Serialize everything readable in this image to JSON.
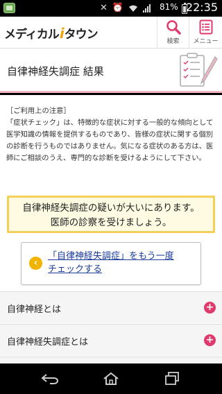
{
  "status_bar": {
    "battery": "81%",
    "time": "22:35"
  },
  "header": {
    "logo_pre": "メディカル",
    "logo_i": "i",
    "logo_post": "タウン",
    "search_label": "検索",
    "menu_label": "メニュー"
  },
  "page": {
    "title": "自律神経失調症 結果"
  },
  "notice": {
    "heading": "［ご利用上の注意］",
    "body": "「症状チェック」は、特徴的な症状に対する一般的な傾向として医学知識の情報を提供するものであり、皆様の症状に関する個別の診断を行うものではありません。気になる症状のある方は、医師にご相談のうえ、専門的な診断を受けるようにして下さい。"
  },
  "result": {
    "line1": "自律神経失調症の疑いが大いにあります。",
    "line2": "医師の診察を受けましょう。"
  },
  "recheck": {
    "icon": "‹",
    "line1": "「自律神経失調症」をもう一度",
    "line2": "チェックする"
  },
  "accordion": [
    {
      "label": "自律神経とは"
    },
    {
      "label": "自律神経失調症とは"
    }
  ],
  "colors": {
    "accent_pink": "#e03a6c",
    "result_border": "#f4cf5a",
    "link": "#1a3a9c"
  }
}
